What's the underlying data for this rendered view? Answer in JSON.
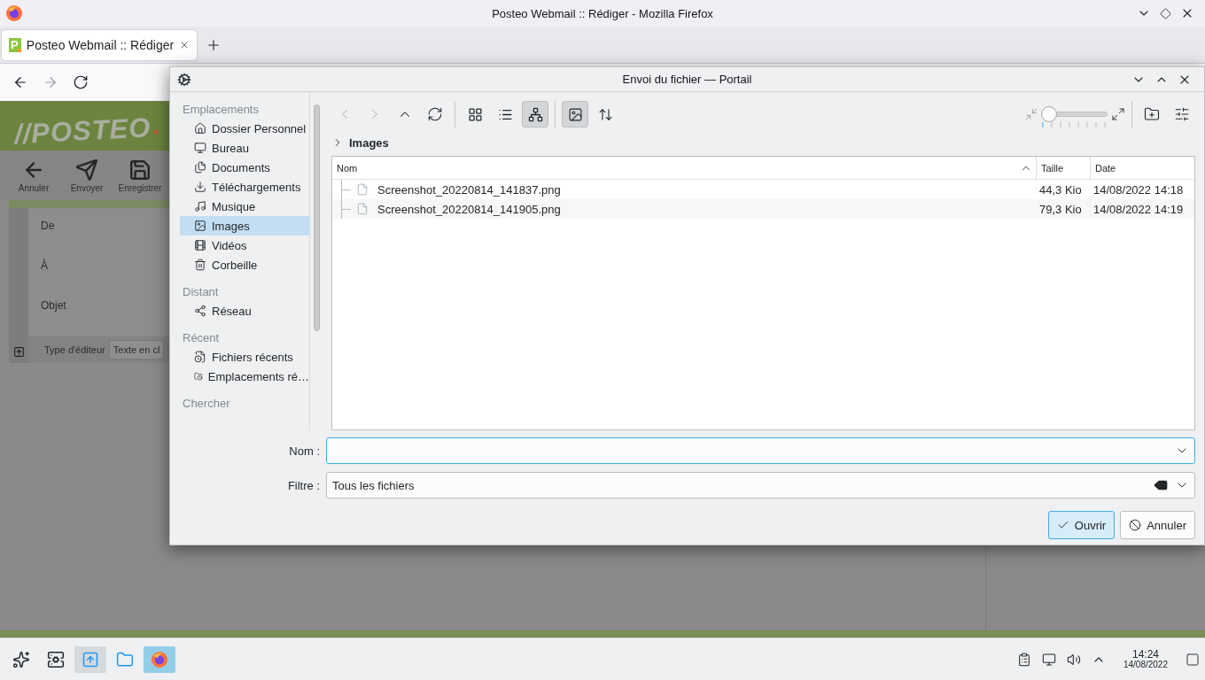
{
  "window": {
    "title": "Posteo Webmail :: Rédiger - Mozilla Firefox"
  },
  "tabs": [
    {
      "label": "Posteo Webmail :: Rédiger",
      "favicon": "P",
      "selected": true
    }
  ],
  "nav_buttons": [
    {
      "kind": "back",
      "disabled": false
    },
    {
      "kind": "forward",
      "disabled": true
    },
    {
      "kind": "reload",
      "disabled": false
    }
  ],
  "page": {
    "logo": "//POSTEO",
    "toolbar": [
      {
        "kind": "back",
        "label": "Annuler"
      },
      {
        "kind": "send",
        "label": "Envoyer"
      },
      {
        "kind": "save",
        "label": "Enregistrer"
      }
    ],
    "fields": [
      {
        "kind": "line",
        "label": "De"
      },
      {
        "kind": "multi",
        "label": "À"
      },
      {
        "kind": "line",
        "label": "Objet"
      }
    ],
    "editor": {
      "label": "Type d'éditeur",
      "value": "Texte en cl"
    }
  },
  "dialog": {
    "title": "Envoi du fichier — Portail",
    "places": [
      {
        "heading": "Emplacements",
        "items": [
          {
            "kind": "home",
            "label": "Dossier Personnel",
            "selected": false
          },
          {
            "kind": "desktop",
            "label": "Bureau",
            "selected": false
          },
          {
            "kind": "documents",
            "label": "Documents",
            "selected": false
          },
          {
            "kind": "downloads",
            "label": "Téléchargements",
            "selected": false
          },
          {
            "kind": "music",
            "label": "Musique",
            "selected": false
          },
          {
            "kind": "pictures",
            "label": "Images",
            "selected": true
          },
          {
            "kind": "videos",
            "label": "Vidéos",
            "selected": false
          },
          {
            "kind": "trash",
            "label": "Corbeille",
            "selected": false
          }
        ]
      },
      {
        "heading": "Distant",
        "items": [
          {
            "kind": "network",
            "label": "Réseau",
            "selected": false
          }
        ]
      },
      {
        "heading": "Récent",
        "items": [
          {
            "kind": "recent-files",
            "label": "Fichiers récents",
            "selected": false
          },
          {
            "kind": "recent-locations",
            "label": "Emplacements ré…",
            "selected": false
          }
        ]
      },
      {
        "heading": "Chercher"
      }
    ],
    "toolbar": {
      "nav": [
        {
          "kind": "back",
          "disabled": true
        },
        {
          "kind": "forward",
          "disabled": true
        },
        {
          "kind": "up",
          "disabled": false
        },
        {
          "kind": "reload",
          "disabled": false
        }
      ],
      "views": [
        {
          "kind": "icons",
          "selected": false
        },
        {
          "kind": "compact",
          "selected": false
        },
        {
          "kind": "tree",
          "selected": true
        }
      ],
      "preview": {
        "on": true
      },
      "zoom": {
        "level": 0
      }
    },
    "breadcrumb": {
      "label": "Images"
    },
    "table": {
      "columns": [
        {
          "label": "Nom",
          "sorted": true
        },
        {
          "label": "Taille",
          "sorted": false
        },
        {
          "label": "Date",
          "sorted": false
        }
      ],
      "rows": [
        {
          "name": "Screenshot_20220814_141837.png",
          "size": "44,3 Kio",
          "date": "14/08/2022 14:18"
        },
        {
          "name": "Screenshot_20220814_141905.png",
          "size": "79,3 Kio",
          "date": "14/08/2022 14:19"
        }
      ]
    },
    "name_field": {
      "label": "Nom :",
      "focused": true
    },
    "filter_field": {
      "label": "Filtre :",
      "value": "Tous les fichiers"
    },
    "buttons": [
      {
        "kind": "ok",
        "label": "Ouvrir",
        "default": true
      },
      {
        "kind": "cancel",
        "label": "Annuler",
        "default": false
      }
    ]
  },
  "taskbar": {
    "apps": [
      {
        "kind": "launcher",
        "open": false,
        "selected": false
      },
      {
        "kind": "monitor",
        "open": false,
        "selected": false
      },
      {
        "kind": "portal",
        "open": true,
        "selected": false
      },
      {
        "kind": "folder",
        "open": false,
        "selected": false
      },
      {
        "kind": "browser",
        "open": true,
        "selected": true
      }
    ],
    "tray": [
      {
        "kind": "clipboard"
      },
      {
        "kind": "network"
      },
      {
        "kind": "volume"
      },
      {
        "kind": "expand"
      }
    ],
    "clock": {
      "time": "14:24",
      "date": "14/08/2022"
    }
  }
}
